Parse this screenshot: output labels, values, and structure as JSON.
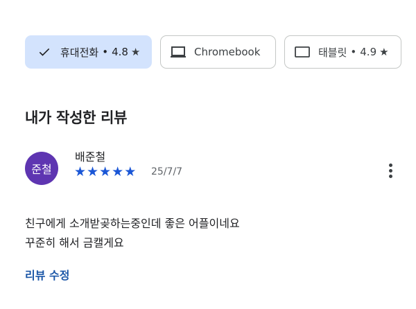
{
  "device_chips": [
    {
      "label": "휴대전화",
      "separator": "•",
      "rating": "4.8",
      "icon": "checkmark-icon",
      "selected": true
    },
    {
      "label": "Chromebook",
      "icon": "laptop-icon",
      "selected": false
    },
    {
      "label": "태블릿",
      "separator": "•",
      "rating": "4.9",
      "icon": "tablet-icon",
      "selected": false
    }
  ],
  "star_glyph": "★",
  "section": {
    "title": "내가 작성한 리뷰"
  },
  "review": {
    "avatar_text": "준철",
    "avatar_color": "#5e35b1",
    "author": "배준철",
    "stars": [
      "★",
      "★",
      "★",
      "★",
      "★"
    ],
    "rating": 5,
    "date": "25/7/7",
    "text_lines": [
      "친구에게 소개받곶하는중인데 좋은 어플이네요",
      "꾸준히 해서 금캘게요"
    ]
  },
  "edit_label": "리뷰 수정",
  "colors": {
    "accent": "#1a56a7",
    "star": "#1a56d6",
    "chip_selected": "#d3e3fd"
  }
}
